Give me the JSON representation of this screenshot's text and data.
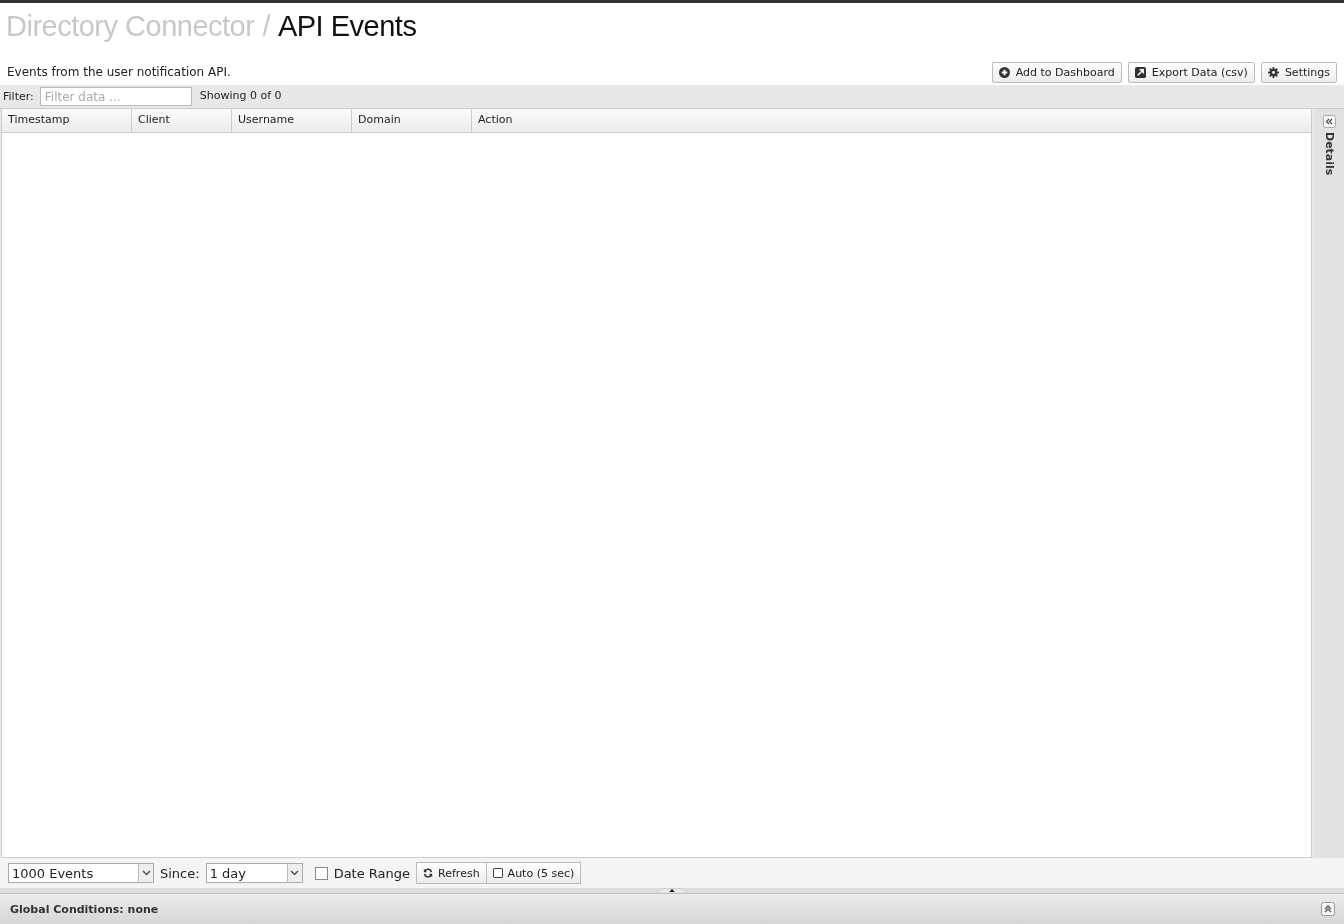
{
  "breadcrumb": {
    "parent": "Directory Connector",
    "separator": "/",
    "title": "API Events"
  },
  "description": "Events from the user notification API.",
  "header_buttons": [
    {
      "kind": "add",
      "label": "Add to Dashboard"
    },
    {
      "kind": "export",
      "label": "Export Data (csv)"
    },
    {
      "kind": "settings",
      "label": "Settings"
    }
  ],
  "filter": {
    "label": "Filter:",
    "placeholder": "Filter data ...",
    "count": "Showing 0 of 0"
  },
  "table": {
    "columns": [
      "Timestamp",
      "Client",
      "Username",
      "Domain",
      "Action"
    ]
  },
  "details_panel": {
    "label": "Details",
    "expanded": false
  },
  "footer": {
    "limit": "1000 Events",
    "since_label": "Since:",
    "since": "1 day",
    "date_range": {
      "label": "Date Range",
      "checked": false
    },
    "refresh": "Refresh",
    "auto": {
      "label": "Auto (5 sec)",
      "checked": false
    }
  },
  "global_conditions": "Global Conditions: none"
}
